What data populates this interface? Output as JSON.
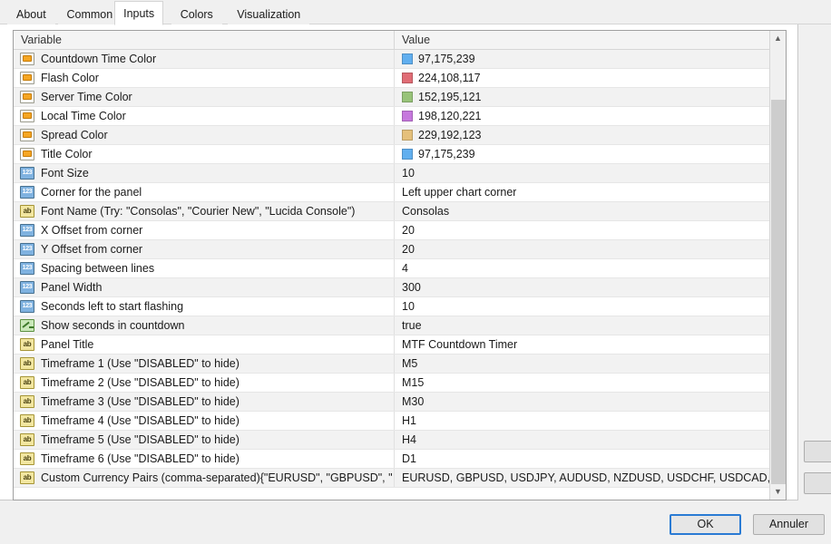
{
  "window": {
    "tabs": [
      {
        "label": "About",
        "active": false
      },
      {
        "label": "Common",
        "active": false
      },
      {
        "label": "Inputs",
        "active": true
      },
      {
        "label": "Colors",
        "active": false
      },
      {
        "label": "Visualization",
        "active": false
      }
    ]
  },
  "grid": {
    "headers": {
      "variable": "Variable",
      "value": "Value"
    },
    "rows": [
      {
        "icon": "color-icon",
        "type": "color",
        "variable": "Countdown Time Color",
        "value": "97,175,239",
        "swatch": "#61afef"
      },
      {
        "icon": "color-icon",
        "type": "color",
        "variable": "Flash Color",
        "value": "224,108,117",
        "swatch": "#e06c75"
      },
      {
        "icon": "color-icon",
        "type": "color",
        "variable": "Server Time Color",
        "value": "152,195,121",
        "swatch": "#98c379"
      },
      {
        "icon": "color-icon",
        "type": "color",
        "variable": "Local Time Color",
        "value": "198,120,221",
        "swatch": "#c678dd"
      },
      {
        "icon": "color-icon",
        "type": "color",
        "variable": "Spread Color",
        "value": "229,192,123",
        "swatch": "#e5c07b"
      },
      {
        "icon": "color-icon",
        "type": "color",
        "variable": "Title Color",
        "value": "97,175,239",
        "swatch": "#61afef"
      },
      {
        "icon": "number-icon",
        "type": "int",
        "variable": "Font Size",
        "value": "10",
        "swatch": null
      },
      {
        "icon": "number-icon",
        "type": "int",
        "variable": "Corner for the panel",
        "value": "Left upper chart corner",
        "swatch": null
      },
      {
        "icon": "text-icon",
        "type": "string",
        "variable": "Font Name (Try: \"Consolas\", \"Courier New\", \"Lucida Console\")",
        "value": "Consolas",
        "swatch": null
      },
      {
        "icon": "number-icon",
        "type": "int",
        "variable": "X Offset from corner",
        "value": "20",
        "swatch": null
      },
      {
        "icon": "number-icon",
        "type": "int",
        "variable": "Y Offset from corner",
        "value": "20",
        "swatch": null
      },
      {
        "icon": "number-icon",
        "type": "int",
        "variable": "Spacing between lines",
        "value": "4",
        "swatch": null
      },
      {
        "icon": "number-icon",
        "type": "int",
        "variable": "Panel Width",
        "value": "300",
        "swatch": null
      },
      {
        "icon": "number-icon",
        "type": "int",
        "variable": "Seconds left to start flashing",
        "value": "10",
        "swatch": null
      },
      {
        "icon": "boolean-icon",
        "type": "bool",
        "variable": "Show seconds in countdown",
        "value": "true",
        "swatch": null
      },
      {
        "icon": "text-icon",
        "type": "string",
        "variable": "Panel Title",
        "value": "MTF Countdown Timer",
        "swatch": null
      },
      {
        "icon": "text-icon",
        "type": "string",
        "variable": "Timeframe 1 (Use \"DISABLED\" to hide)",
        "value": "M5",
        "swatch": null
      },
      {
        "icon": "text-icon",
        "type": "string",
        "variable": "Timeframe 2 (Use \"DISABLED\" to hide)",
        "value": "M15",
        "swatch": null
      },
      {
        "icon": "text-icon",
        "type": "string",
        "variable": "Timeframe 3 (Use \"DISABLED\" to hide)",
        "value": "M30",
        "swatch": null
      },
      {
        "icon": "text-icon",
        "type": "string",
        "variable": "Timeframe 4 (Use \"DISABLED\" to hide)",
        "value": "H1",
        "swatch": null
      },
      {
        "icon": "text-icon",
        "type": "string",
        "variable": "Timeframe 5 (Use \"DISABLED\" to hide)",
        "value": "H4",
        "swatch": null
      },
      {
        "icon": "text-icon",
        "type": "string",
        "variable": "Timeframe 6 (Use \"DISABLED\" to hide)",
        "value": "D1",
        "swatch": null
      },
      {
        "icon": "text-icon",
        "type": "string",
        "variable": "Custom Currency Pairs (comma-separated){\"EURUSD\", \"GBPUSD\", \"US",
        "value": "EURUSD, GBPUSD, USDJPY, AUDUSD, NZDUSD, USDCHF, USDCAD, EUR…",
        "swatch": null
      }
    ]
  },
  "scrollbar": {
    "up_glyph": "▲",
    "down_glyph": "▼"
  },
  "icon_chars": {
    "int": "123",
    "str": "ab"
  },
  "buttons": {
    "ok": "OK",
    "cancel": "Annuler"
  }
}
